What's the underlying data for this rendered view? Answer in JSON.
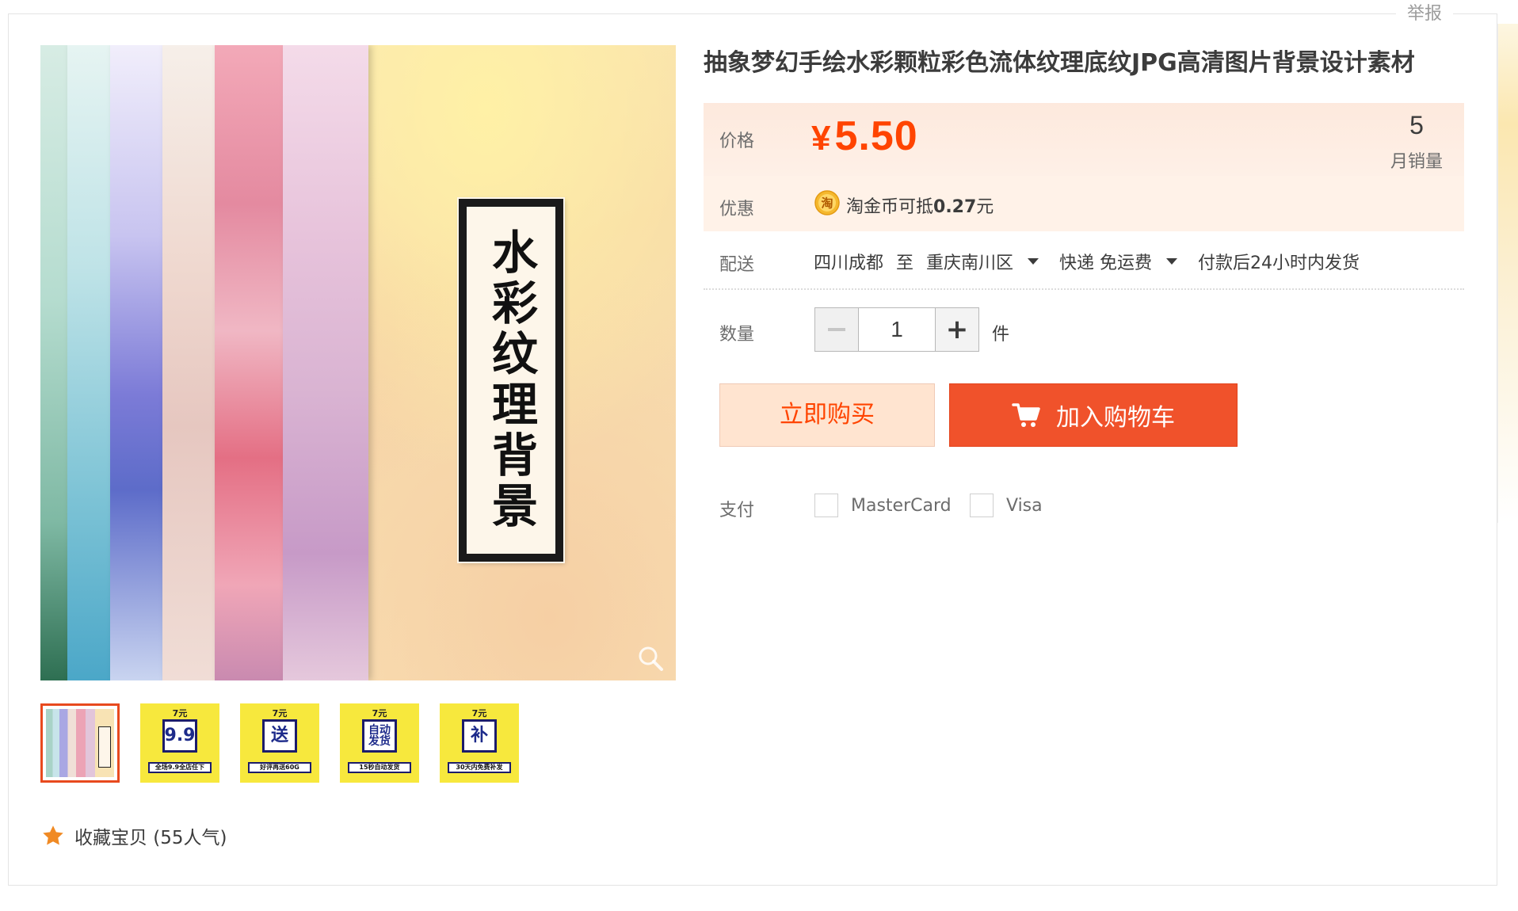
{
  "report_link": "举报",
  "product": {
    "title": "抽象梦幻手绘水彩颗粒彩色流体纹理底纹JPG高清图片背景设计素材",
    "main_image_caption": "水彩纹理背景"
  },
  "thumbnails": [
    {
      "type": "image",
      "active": true
    },
    {
      "type": "badge",
      "top": "7元",
      "big": "9.9",
      "bar": "全场9.9全店任下"
    },
    {
      "type": "badge",
      "top": "7元",
      "big": "送",
      "bar": "好评再送60G"
    },
    {
      "type": "badge",
      "top": "7元",
      "big": "自动发货",
      "bar": "15秒自动发货"
    },
    {
      "type": "badge",
      "top": "7元",
      "big": "补",
      "bar": "30天内免费补发"
    }
  ],
  "favorite": {
    "label": "收藏宝贝 (55人气)"
  },
  "price": {
    "label": "价格",
    "currency": "¥",
    "value": "5.50",
    "color": "#ff4400"
  },
  "sales": {
    "count": "5",
    "label": "月销量"
  },
  "promo": {
    "label": "优惠",
    "icon": "淘",
    "text_prefix": "淘金币可抵",
    "amount": "0.27",
    "suffix": "元"
  },
  "shipping": {
    "label": "配送",
    "from": "四川成都",
    "to_word": "至",
    "destination": "重庆南川区",
    "method": "快递 免运费",
    "dispatch": "付款后24小时内发货"
  },
  "quantity": {
    "label": "数量",
    "value": "1",
    "unit": "件"
  },
  "buttons": {
    "buy_now": "立即购买",
    "add_to_cart": "加入购物车",
    "accent": "#f0522b"
  },
  "payment": {
    "label": "支付",
    "options": [
      "MasterCard",
      "Visa"
    ]
  }
}
